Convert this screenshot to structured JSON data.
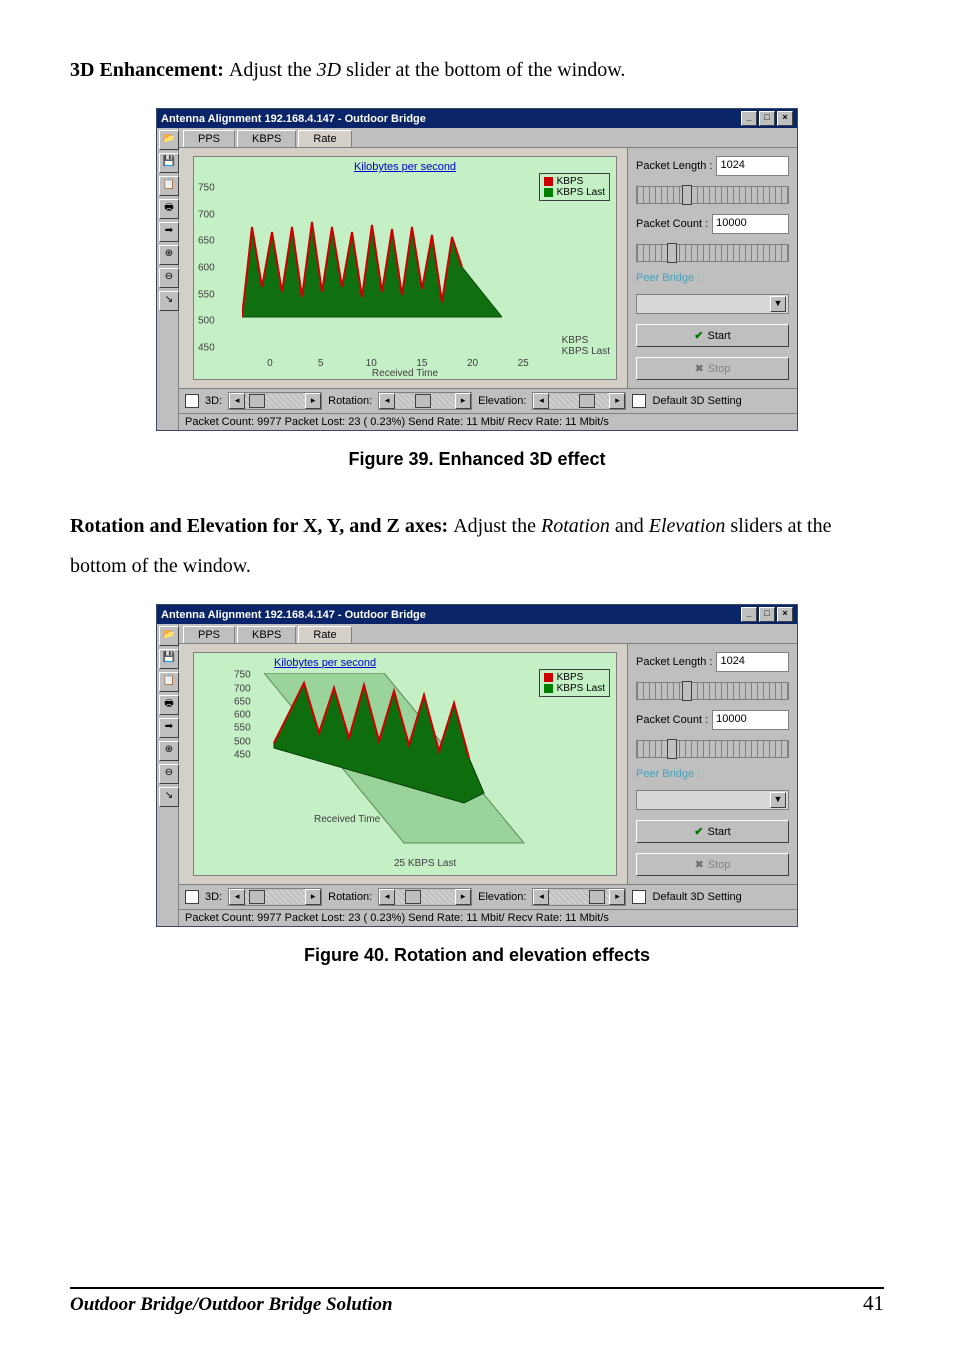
{
  "para1": {
    "bold": "3D Enhancement: ",
    "rest_a": "Adjust the ",
    "italic": "3D",
    "rest_b": " slider at the bottom of the window."
  },
  "fig39_caption": "Figure 39.  Enhanced 3D effect",
  "para2": {
    "bold": "Rotation and Elevation for X, Y, and Z axes: ",
    "rest_a": "Adjust the ",
    "italic1": "Rotation",
    "rest_b": " and ",
    "italic2": "Elevation",
    "rest_c": " sliders at the bottom of the window."
  },
  "fig40_caption": "Figure 40.  Rotation and elevation effects",
  "win": {
    "title": "Antenna Alignment 192.168.4.147 - Outdoor Bridge",
    "tabs": {
      "pps": "PPS",
      "kbps": "KBPS",
      "rate": "Rate"
    },
    "chart_title": "Kilobytes per second",
    "legend": {
      "a": "KBPS",
      "b": "KBPS Last"
    },
    "yticks_39": [
      "750",
      "700",
      "650",
      "600",
      "550",
      "500",
      "450"
    ],
    "yticks_40": [
      "750",
      "700",
      "650",
      "600",
      "550",
      "500",
      "450"
    ],
    "xticks": [
      "0",
      "5",
      "10",
      "15",
      "20",
      "25"
    ],
    "xaxis": "Received Time",
    "axis_end_a": "KBPS",
    "axis_end_b": "KBPS Last",
    "axis_end_40": "25 KBPS Last",
    "side": {
      "pkt_len_label": "Packet Length :",
      "pkt_len_value": "1024",
      "pkt_cnt_label": "Packet Count :",
      "pkt_cnt_value": "10000",
      "peer_label": "Peer Bridge :",
      "start": "Start",
      "stop": "Stop"
    },
    "bottom": {
      "3d": "3D:",
      "rotation": "Rotation:",
      "elevation": "Elevation:",
      "default3d": "Default 3D Setting"
    },
    "status": "Packet Count: 9977   Packet Lost: 23 ( 0.23%) Send Rate: 11 Mbit/ Recv Rate: 11 Mbit/s"
  },
  "footer": {
    "left": "Outdoor Bridge/Outdoor Bridge Solution",
    "right": "41"
  },
  "chart_data": [
    {
      "figure": 39,
      "type": "line",
      "title": "Kilobytes per second",
      "xlabel": "Received Time",
      "ylabel": "",
      "xlim": [
        0,
        25
      ],
      "ylim": [
        450,
        750
      ],
      "series": [
        {
          "name": "KBPS",
          "color": "#cc0000"
        },
        {
          "name": "KBPS Last",
          "color": "#008000"
        }
      ],
      "note": "3D area/line chart, jagged waveform roughly 550–700 range, values estimated from gridlines"
    },
    {
      "figure": 40,
      "type": "line",
      "title": "Kilobytes per second",
      "xlabel": "Received Time",
      "ylabel": "",
      "xlim": [
        0,
        25
      ],
      "ylim": [
        450,
        750
      ],
      "series": [
        {
          "name": "KBPS",
          "color": "#cc0000"
        },
        {
          "name": "KBPS Last",
          "color": "#008000"
        }
      ],
      "note": "Same data as fig 39 but rotated/elevated 3D perspective"
    }
  ]
}
